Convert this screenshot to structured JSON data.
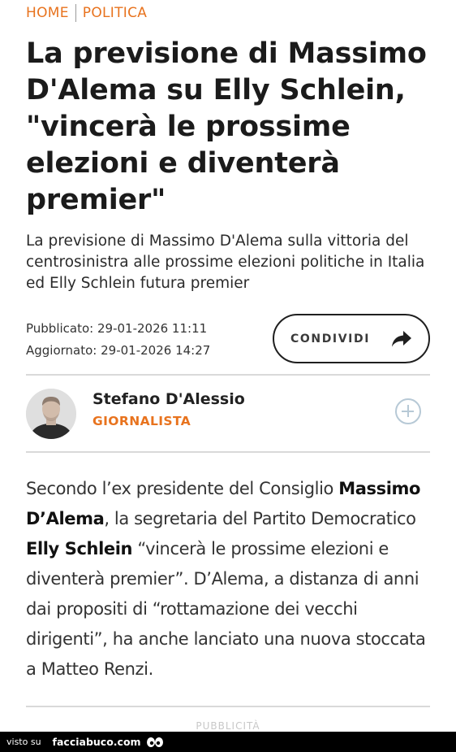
{
  "breadcrumb": {
    "home": "HOME",
    "section": "POLITICA"
  },
  "article": {
    "title": "La previsione di Massimo D'Alema su Elly Schlein, \"vincerà le prossime elezioni e diventerà premier\"",
    "subtitle": "La previsione di Massimo D'Alema sulla vittoria del centrosinistra alle prossime elezioni politiche in Italia ed Elly Schlein futura premier",
    "published": "Pubblicato: 29-01-2026 11:11",
    "updated": "Aggiornato: 29-01-2026 14:27",
    "share_label": "CONDIVIDI",
    "share_icon": "share-arrow-icon"
  },
  "author": {
    "name": "Stefano D'Alessio",
    "role": "GIORNALISTA",
    "follow_icon": "plus-circle-icon"
  },
  "body": [
    "Secondo l’ex presidente del Consiglio ",
    "Massimo D’Alema",
    ", la segretaria del Partito Democratico ",
    "Elly Schlein",
    " “vincerà le prossime elezioni e diventerà premier”. D’Alema, a distanza di anni dai propositi di “rottamazione dei vecchi dirigenti”, ha anche lanciato una nuova stoccata a Matteo Renzi."
  ],
  "ad_label": "PUBBLICITÀ",
  "watermark": {
    "prefix": "visto su",
    "site": "facciabuco.com"
  },
  "colors": {
    "accent": "#e8731e",
    "follow": "#b7c9d6",
    "text": "#1b1b1b"
  }
}
